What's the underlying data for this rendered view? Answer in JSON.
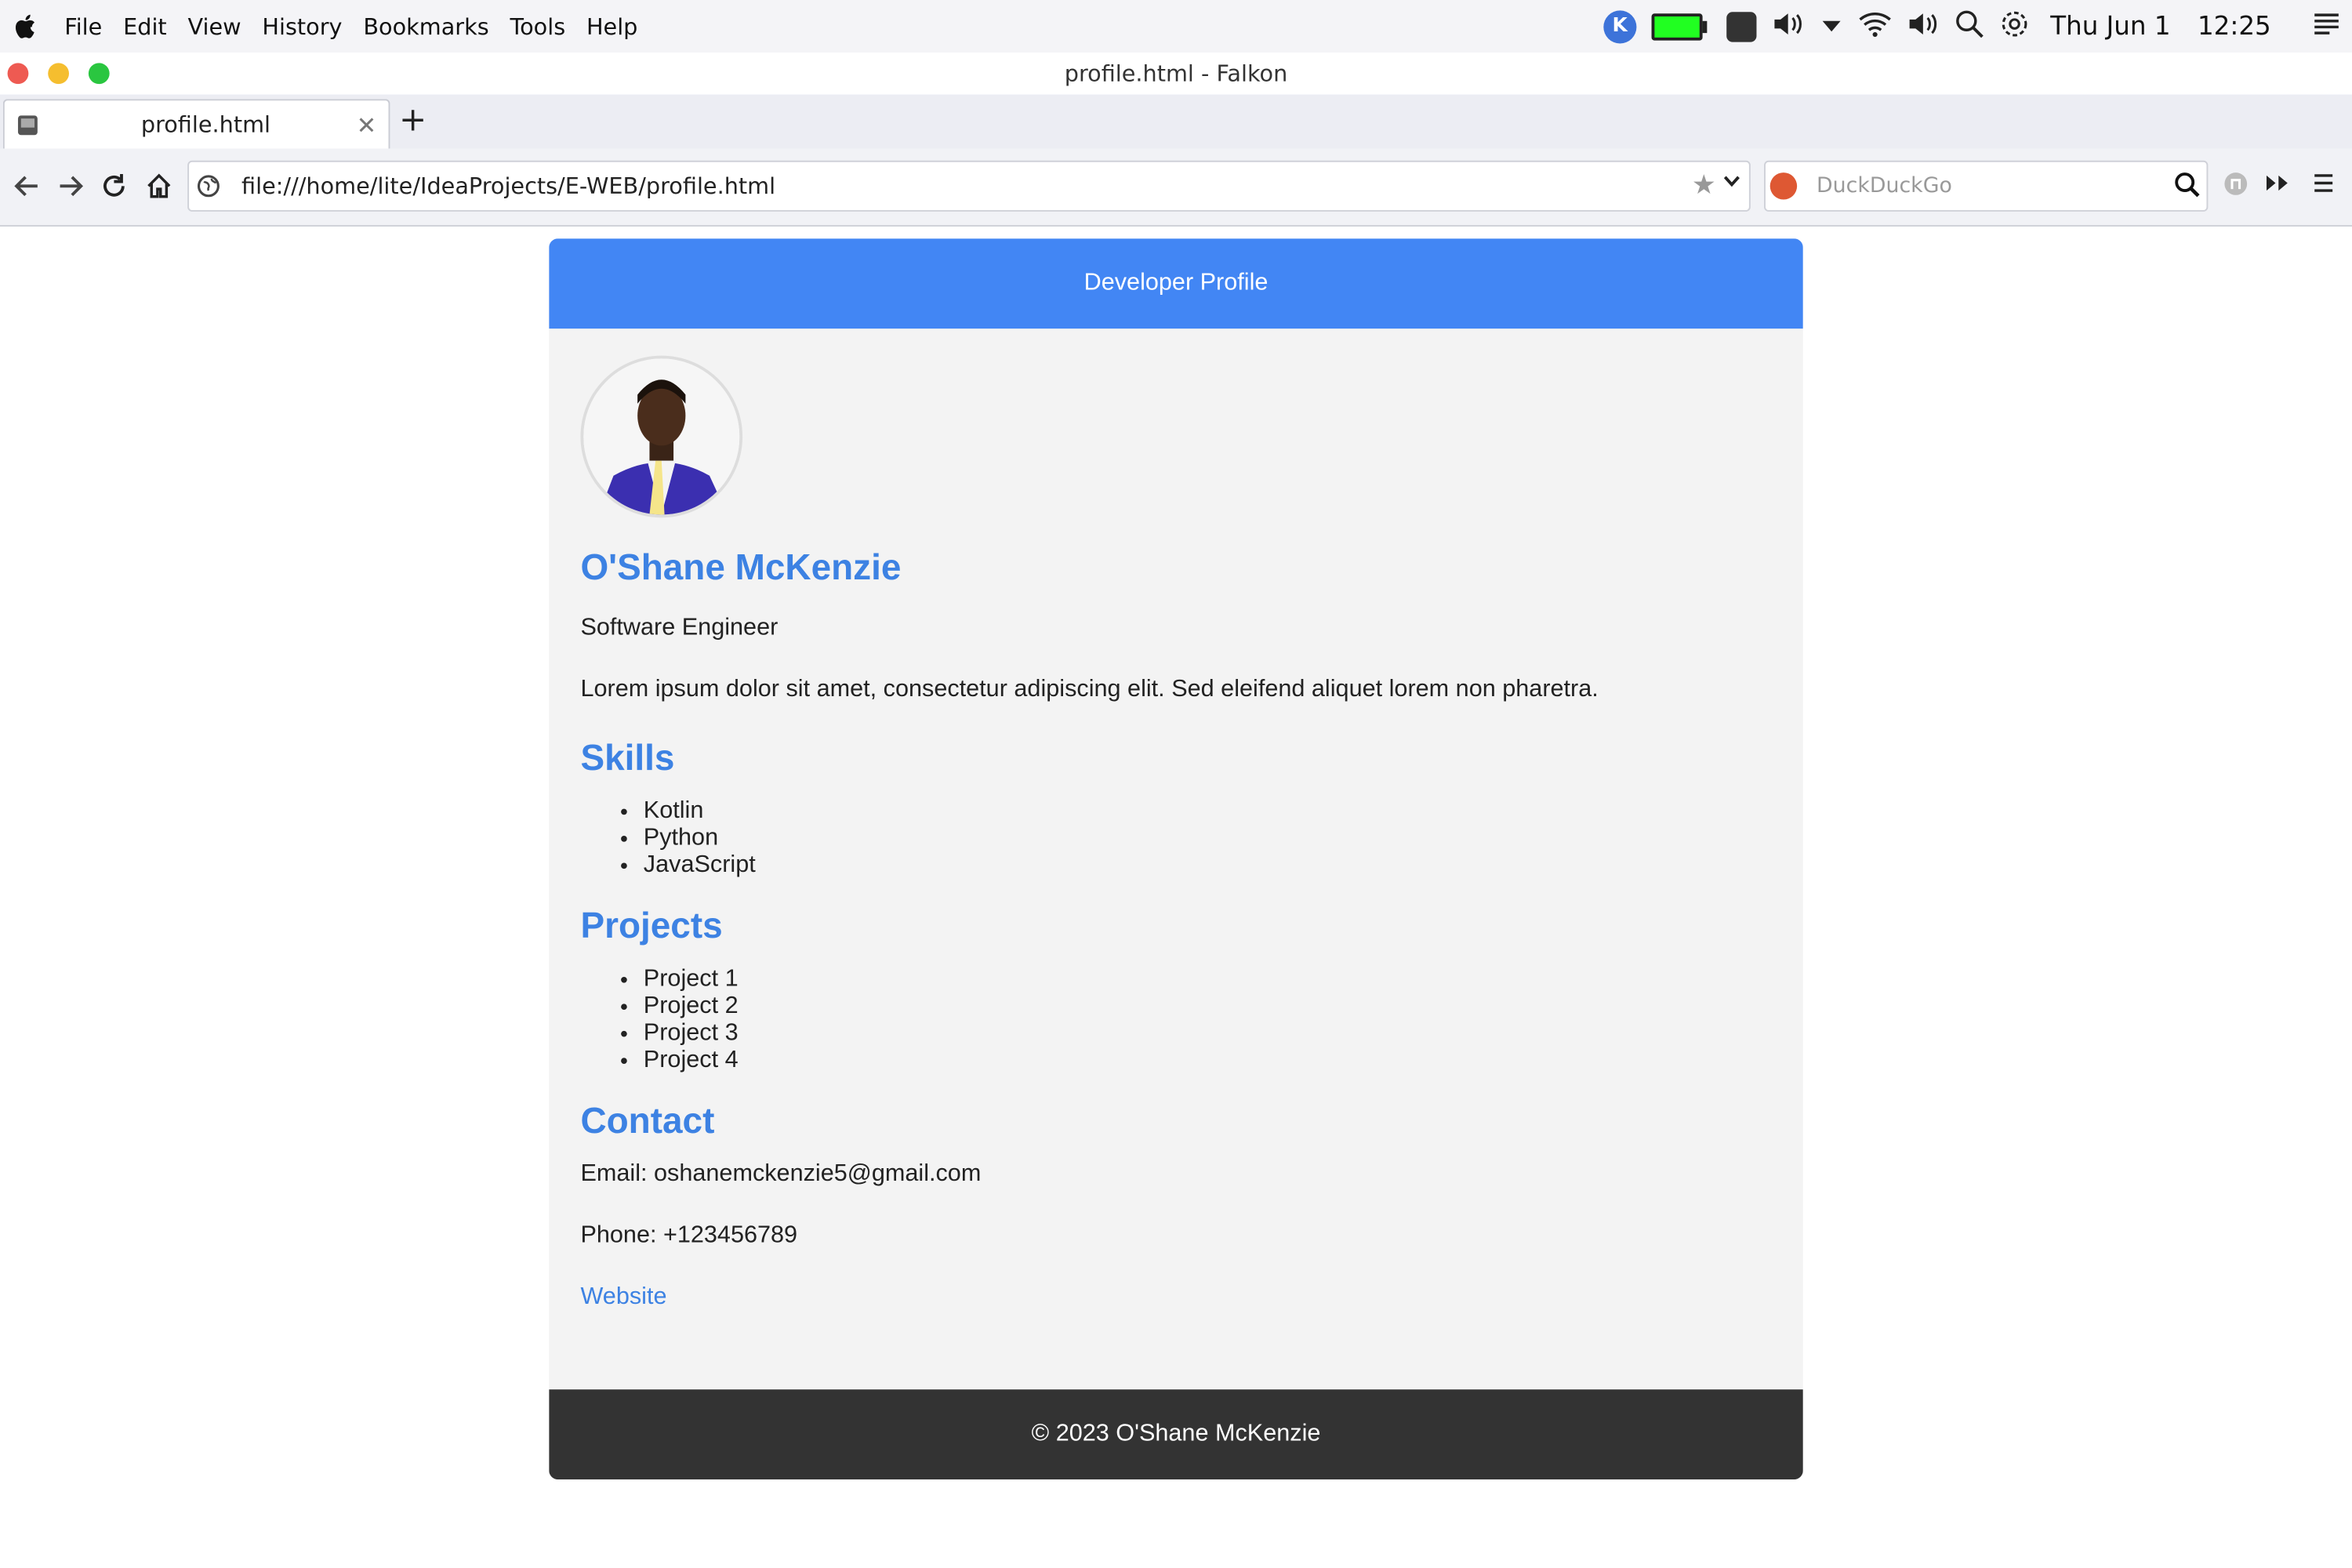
{
  "menubar": {
    "items": [
      "File",
      "Edit",
      "View",
      "History",
      "Bookmarks",
      "Tools",
      "Help"
    ],
    "date": "Thu Jun 1",
    "time": "12:25"
  },
  "window": {
    "title": "profile.html - Falkon"
  },
  "tabs": [
    {
      "label": "profile.html"
    }
  ],
  "navbar": {
    "url": "file:///home/lite/IdeaProjects/E-WEB/profile.html",
    "search_placeholder": "DuckDuckGo"
  },
  "page": {
    "header": "Developer Profile",
    "name": "O'Shane McKenzie",
    "role": "Software Engineer",
    "bio": "Lorem ipsum dolor sit amet, consectetur adipiscing elit. Sed eleifend aliquet lorem non pharetra.",
    "skills_heading": "Skills",
    "skills": [
      "Kotlin",
      "Python",
      "JavaScript"
    ],
    "projects_heading": "Projects",
    "projects": [
      "Project 1",
      "Project 2",
      "Project 3",
      "Project 4"
    ],
    "contact_heading": "Contact",
    "email": "Email: oshanemckenzie5@gmail.com",
    "phone": "Phone: +123456789",
    "website_label": "Website",
    "footer": "© 2023 O'Shane McKenzie"
  },
  "colors": {
    "header_bg": "#4286f4",
    "heading": "#3d82e3",
    "footer_bg": "#333333"
  }
}
